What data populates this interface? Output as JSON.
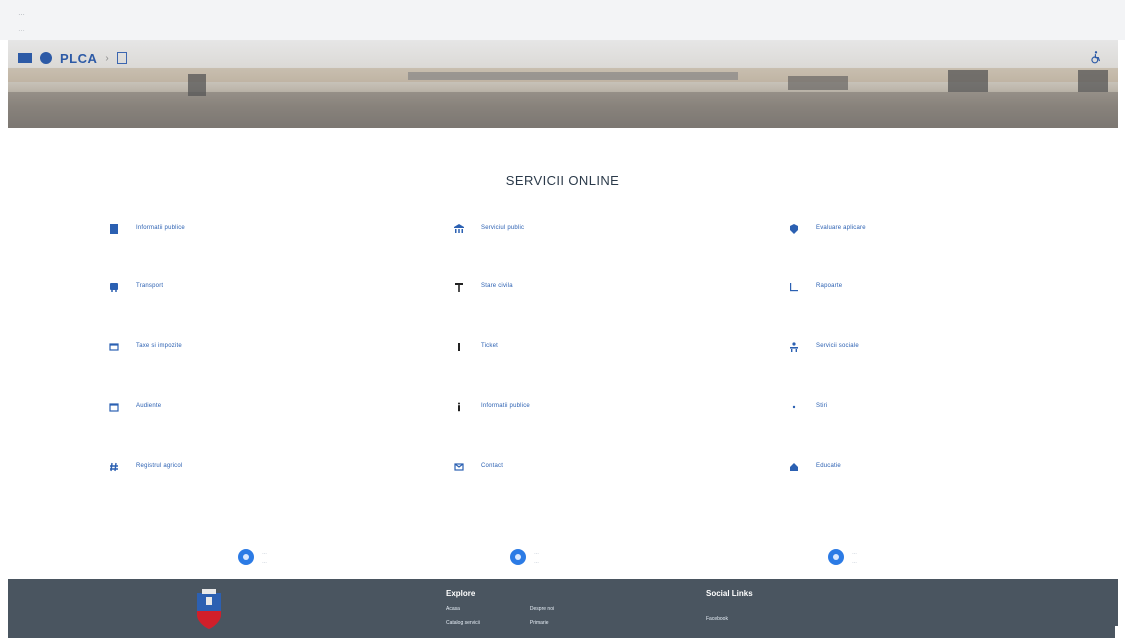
{
  "browser": {
    "line1": "…",
    "line2": "…"
  },
  "header": {
    "brand": "PLCA",
    "separator": "›",
    "accessibility_icon": "wheelchair-icon"
  },
  "main": {
    "title": "SERVICII ONLINE",
    "services": [
      {
        "label": "Informatii publice",
        "icon": "building-icon"
      },
      {
        "label": "Serviciul public",
        "icon": "bank-icon"
      },
      {
        "label": "Evaluare aplicare",
        "icon": "badge-icon"
      },
      {
        "label": "Transport",
        "icon": "bus-icon"
      },
      {
        "label": "Stare civila",
        "icon": "key-icon"
      },
      {
        "label": "Rapoarte",
        "icon": "chart-icon"
      },
      {
        "label": "Taxe si impozite",
        "icon": "wallet-icon"
      },
      {
        "label": "Ticket",
        "icon": "info-icon"
      },
      {
        "label": "Servicii sociale",
        "icon": "people-icon"
      },
      {
        "label": "Audiente",
        "icon": "calendar-icon"
      },
      {
        "label": "Informatii publice",
        "icon": "info-icon"
      },
      {
        "label": "Stiri",
        "icon": "dot-icon"
      },
      {
        "label": "Registrul agricol",
        "icon": "hash-icon"
      },
      {
        "label": "Contact",
        "icon": "mail-icon"
      },
      {
        "label": "Educatie",
        "icon": "home-icon"
      }
    ]
  },
  "contact": [
    {
      "line1": "…",
      "line2": "…"
    },
    {
      "line1": "…",
      "line2": "…"
    },
    {
      "line1": "…",
      "line2": "…"
    }
  ],
  "footer": {
    "explore_title": "Explore",
    "explore_links_col1": [
      "Acasa",
      "Catalog servicii"
    ],
    "explore_links_col2": [
      "Despre noi",
      "Primarie"
    ],
    "social_title": "Social Links",
    "social_links": [
      "Facebook"
    ]
  },
  "colors": {
    "accent": "#2b60b2",
    "footer_bg": "#4a5560",
    "contact_circle": "#2c7be5"
  }
}
